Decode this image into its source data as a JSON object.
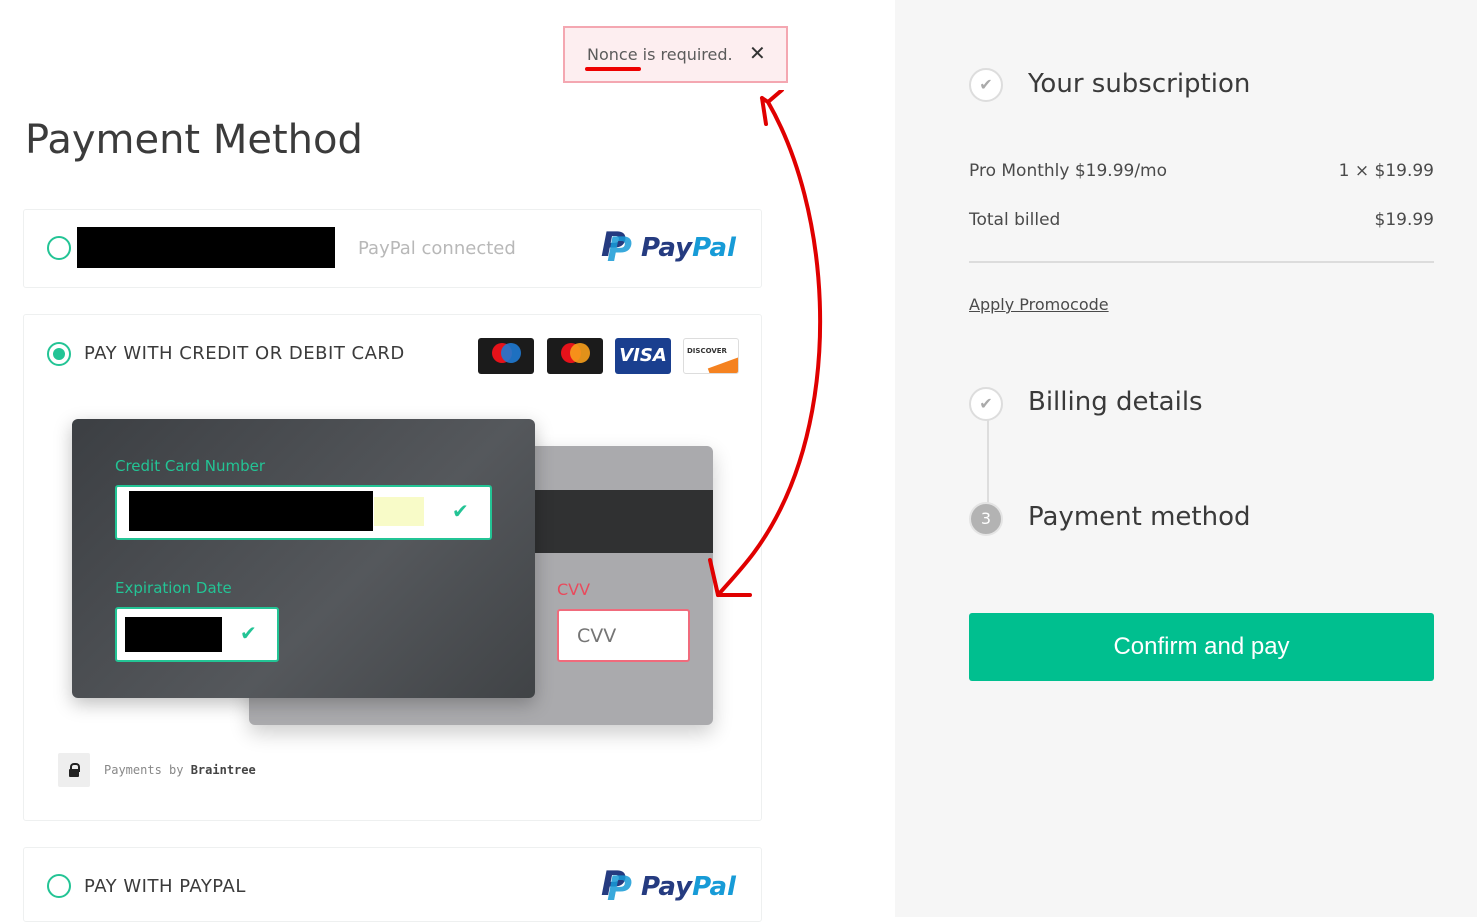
{
  "toast": {
    "message": "Nonce is required.",
    "close_glyph": "✕"
  },
  "page_title": "Payment Method",
  "saved_paypal": {
    "status": "PayPal connected",
    "logo_pay": "Pay",
    "logo_pal": "Pal"
  },
  "card_option": {
    "label": "PAY WITH CREDIT OR DEBIT CARD",
    "logos": [
      "maestro-icon",
      "mastercard-icon",
      "visa-icon",
      "discover-icon"
    ],
    "visa_text": "VISA",
    "discover_text": "DISCOVER"
  },
  "card_form": {
    "number_label": "Credit Card Number",
    "expiry_label": "Expiration Date",
    "cvv_label": "CVV",
    "cvv_placeholder": "CVV",
    "check_glyph": "✔"
  },
  "braintree": {
    "text_prefix": "Payments by ",
    "text_brand": "Braintree"
  },
  "paypal_option": {
    "label": "PAY WITH PAYPAL",
    "logo_pay": "Pay",
    "logo_pal": "Pal"
  },
  "summary": {
    "subscription_title": "Your subscription",
    "item_name": "Pro Monthly $19.99/mo",
    "item_qty_price": "1 × $19.99",
    "total_label": "Total billed",
    "total_value": "$19.99",
    "promo_link": "Apply Promocode"
  },
  "steps": {
    "billing": "Billing details",
    "payment": "Payment method",
    "payment_number": "3",
    "done_glyph": "✔"
  },
  "confirm_button": "Confirm and pay",
  "colors": {
    "accent": "#00bf8f",
    "error": "#e00000",
    "paypal_dark": "#253b80",
    "paypal_light": "#179bd7"
  }
}
